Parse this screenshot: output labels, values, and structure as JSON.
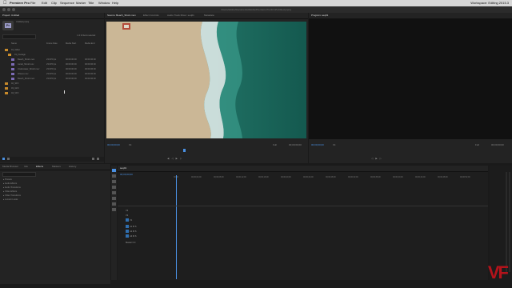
{
  "menubar": {
    "app": "Premiere Pro",
    "menus": [
      "File",
      "Edit",
      "Clip",
      "Sequence",
      "Marker",
      "Title",
      "Window",
      "Help"
    ],
    "right": "Workspace: Editing 2015.3"
  },
  "window_title": "/Users/adobe/Documents/Adobe/Premiere Pro/10.0/Untitled.prproj",
  "project_panel": {
    "tab": "Project: Untitled",
    "project_name": "Untitled.prproj",
    "search_placeholder": "",
    "item_count": "1 of 10 items selected",
    "columns": [
      "Name",
      "Frame Rate",
      "Media Start",
      "Media End"
    ],
    "items": [
      {
        "name": "01_Video",
        "kind": "bin"
      },
      {
        "name": "01_Footage",
        "kind": "bin"
      },
      {
        "name": "Beach_Shot1.mov",
        "fps": "23.976 fps",
        "start": "00:00:00:00",
        "end": "00:00:06:00"
      },
      {
        "name": "Aerial_Shot2.mov",
        "fps": "23.976 fps",
        "start": "00:00:00:00",
        "end": "00:00:06:00"
      },
      {
        "name": "Underwater_Shot3.mov",
        "fps": "23.976 fps",
        "start": "00:00:00:00",
        "end": "00:00:06:00"
      },
      {
        "name": "Waves.mov",
        "fps": "23.976 fps",
        "start": "00:00:00:00",
        "end": "00:00:06:00"
      },
      {
        "name": "Beach_Shot4.mov",
        "fps": "23.976 fps",
        "start": "00:00:00:00",
        "end": "00:00:06:00"
      },
      {
        "name": "02_SFX",
        "kind": "bin"
      },
      {
        "name": "03_GFX",
        "kind": "bin"
      },
      {
        "name": "04_VFX",
        "kind": "bin"
      }
    ]
  },
  "source_monitor": {
    "tabs": [
      "Source: Beach_Shot1.mov",
      "Effect Controls",
      "Audio Track Mixer: seq01",
      "Metadata"
    ],
    "timecode_in": "00;00;00;00",
    "fit": "Fit",
    "fraction": "Full",
    "duration": "00;00;00;00"
  },
  "program_monitor": {
    "tab": "Program: seq01",
    "timecode": "00;00;00;00",
    "fit": "Fit",
    "fraction": "Full",
    "duration": "00;00;00;00"
  },
  "effects_panel": {
    "tabs": [
      "Media Browser",
      "Info",
      "Effects",
      "Markers",
      "History"
    ],
    "items": [
      "Presets",
      "Audio Effects",
      "Audio Transitions",
      "Video Effects",
      "Video Transitions",
      "Lumetri Looks"
    ]
  },
  "timeline": {
    "tab": "seq01",
    "timecode": "00;00;00;00",
    "ruler": [
      "00;00",
      "00;00;04;00",
      "00;00;08;00",
      "00;00;12;00",
      "00;00;16;00",
      "00;00;20;00",
      "00;00;24;00",
      "00;00;28;00",
      "00;00;32;00",
      "00;00;36;00",
      "00;00;40;00",
      "00;00;44;00",
      "00;00;48;00",
      "00;00;52;00"
    ],
    "video_tracks": [
      "V3",
      "V2",
      "V1"
    ],
    "audio_tracks": [
      "A1",
      "A2",
      "A3"
    ],
    "master": "Master",
    "master_value": "0.0"
  },
  "watermark": "VF",
  "colors": {
    "accent": "#4a90e2",
    "watermark": "#b3131b"
  }
}
